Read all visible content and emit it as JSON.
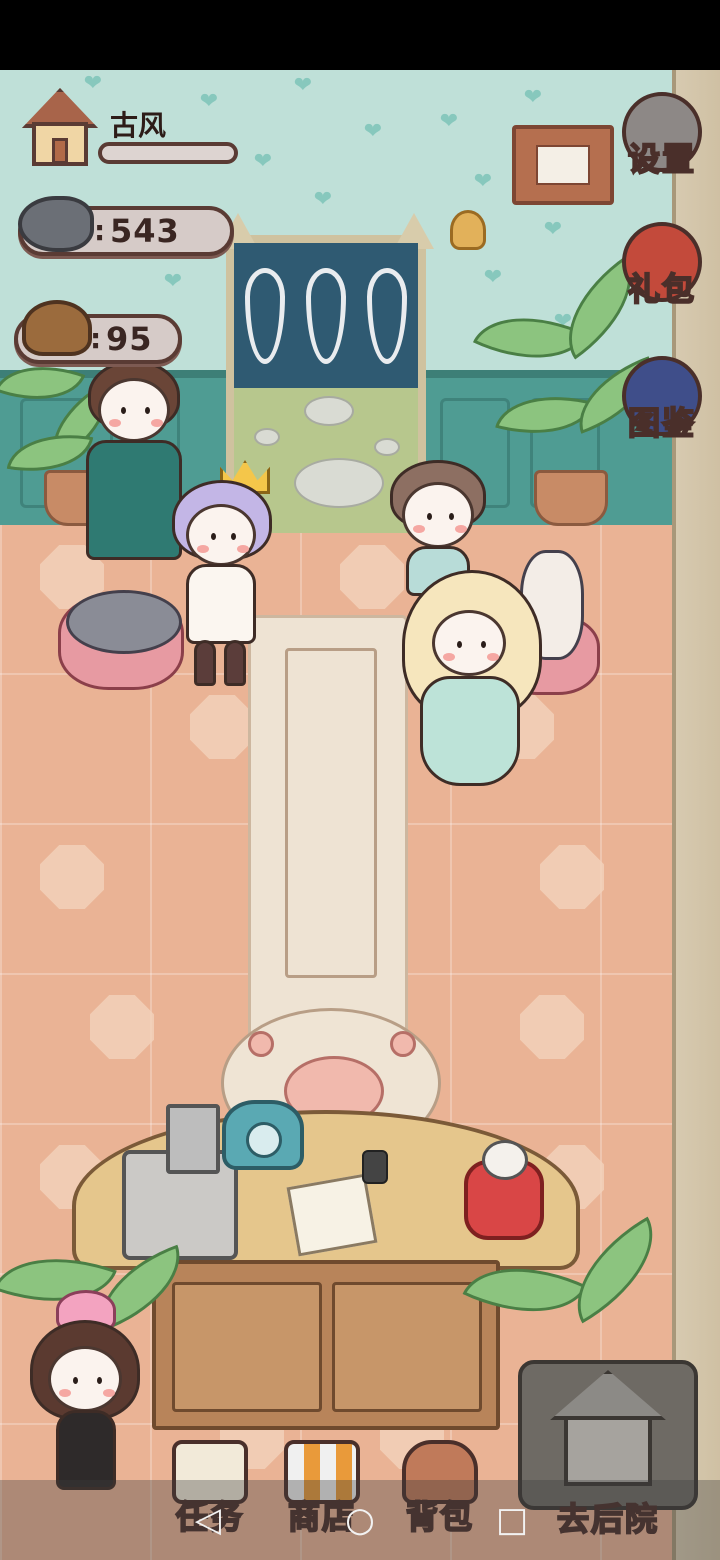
{
  "hud": {
    "hall_name": "古风",
    "exp_progress": 0.0,
    "fish_count": "543",
    "poop_count": "95",
    "separator": ":"
  },
  "side_menu": {
    "settings_label": "设置",
    "gift_label": "礼包",
    "catalog_label": "图鉴"
  },
  "bottom_menu": {
    "tasks_label": "任务",
    "shop_label": "商店",
    "backpack_label": "背包",
    "backyard_label": "去后院"
  },
  "icons": {
    "house": "house-icon",
    "fish": "fish-icon",
    "poop": "poop-icon",
    "settings": "gear-icon",
    "gift": "gift-bag-icon",
    "catalog": "book-icon",
    "nav_back": "◁",
    "nav_home": "○",
    "nav_recent": "□"
  },
  "colors": {
    "wall": "#bfe0d8",
    "wainscot": "#4f9c93",
    "floor": "#eab395",
    "outline": "#4a2f2a"
  }
}
